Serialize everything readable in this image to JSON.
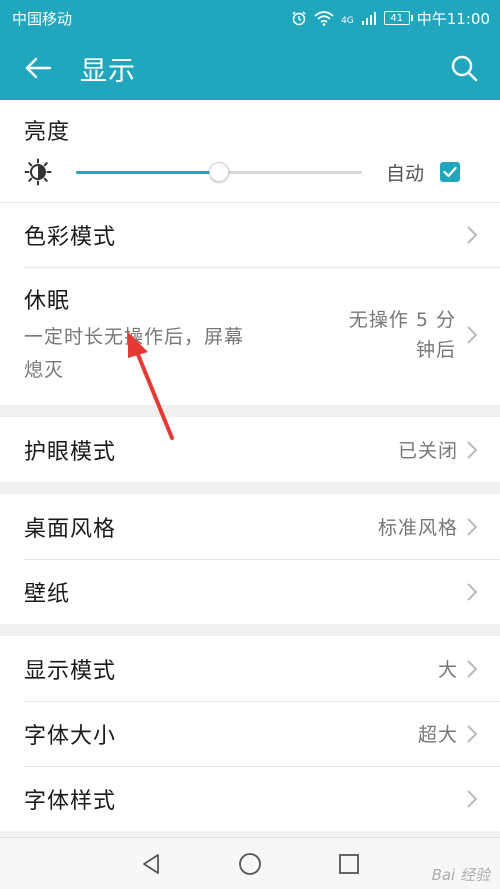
{
  "status": {
    "carrier": "中国移动",
    "network": "4G",
    "battery": "41",
    "time": "中午11:00"
  },
  "app_bar": {
    "title": "显示"
  },
  "brightness": {
    "label": "亮度",
    "level": 0.5,
    "auto_label": "自动",
    "auto_checked": true
  },
  "rows": {
    "color_mode": {
      "label": "色彩模式"
    },
    "sleep": {
      "label": "休眠",
      "subtitle_line1": "一定时长无操作后，屏幕",
      "subtitle_line2": "熄灭",
      "value_line1": "无操作 5 分",
      "value_line2": "钟后"
    },
    "eye_comfort": {
      "label": "护眼模式",
      "value": "已关闭"
    },
    "desktop_style": {
      "label": "桌面风格",
      "value": "标准风格"
    },
    "wallpaper": {
      "label": "壁纸"
    },
    "display_mode": {
      "label": "显示模式",
      "value": "大"
    },
    "font_size": {
      "label": "字体大小",
      "value": "超大"
    },
    "font_style": {
      "label": "字体样式"
    }
  },
  "watermark": "Bai 经验",
  "colors": {
    "accent": "#21a7bd",
    "annotation_arrow": "#e53935"
  }
}
